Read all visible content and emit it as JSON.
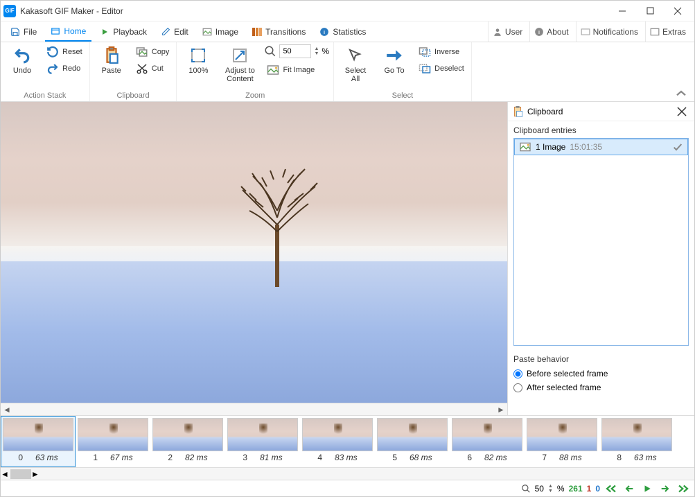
{
  "window": {
    "title": "Kakasoft GIF Maker - Editor",
    "app_icon_text": "GIF"
  },
  "tabs": {
    "file": "File",
    "home": "Home",
    "playback": "Playback",
    "edit": "Edit",
    "image": "Image",
    "transitions": "Transitions",
    "statistics": "Statistics",
    "user": "User",
    "about": "About",
    "notifications": "Notifications",
    "extras": "Extras"
  },
  "ribbon": {
    "action_stack": {
      "label": "Action Stack",
      "undo": "Undo",
      "reset": "Reset",
      "redo": "Redo"
    },
    "clipboard": {
      "label": "Clipboard",
      "paste": "Paste",
      "copy": "Copy",
      "cut": "Cut"
    },
    "zoom": {
      "label": "Zoom",
      "hundred": "100%",
      "adjust": "Adjust to Content",
      "value": "50",
      "percent": "%",
      "fit": "Fit Image"
    },
    "select": {
      "label": "Select",
      "select_all": "Select All",
      "go_to": "Go To",
      "inverse": "Inverse",
      "deselect": "Deselect"
    }
  },
  "clipboard_panel": {
    "title": "Clipboard",
    "entries_label": "Clipboard entries",
    "entry": {
      "text": "1 Image",
      "time": "15:01:35"
    },
    "paste_behavior_label": "Paste behavior",
    "before": "Before selected frame",
    "after": "After selected frame"
  },
  "frames": [
    {
      "idx": "0",
      "ms": "63 ms"
    },
    {
      "idx": "1",
      "ms": "67 ms"
    },
    {
      "idx": "2",
      "ms": "82 ms"
    },
    {
      "idx": "3",
      "ms": "81 ms"
    },
    {
      "idx": "4",
      "ms": "83 ms"
    },
    {
      "idx": "5",
      "ms": "68 ms"
    },
    {
      "idx": "6",
      "ms": "82 ms"
    },
    {
      "idx": "7",
      "ms": "88 ms"
    },
    {
      "idx": "8",
      "ms": "63 ms"
    }
  ],
  "status": {
    "zoom": "50",
    "percent": "%",
    "frames": "261",
    "sel": "1",
    "other": "0"
  }
}
